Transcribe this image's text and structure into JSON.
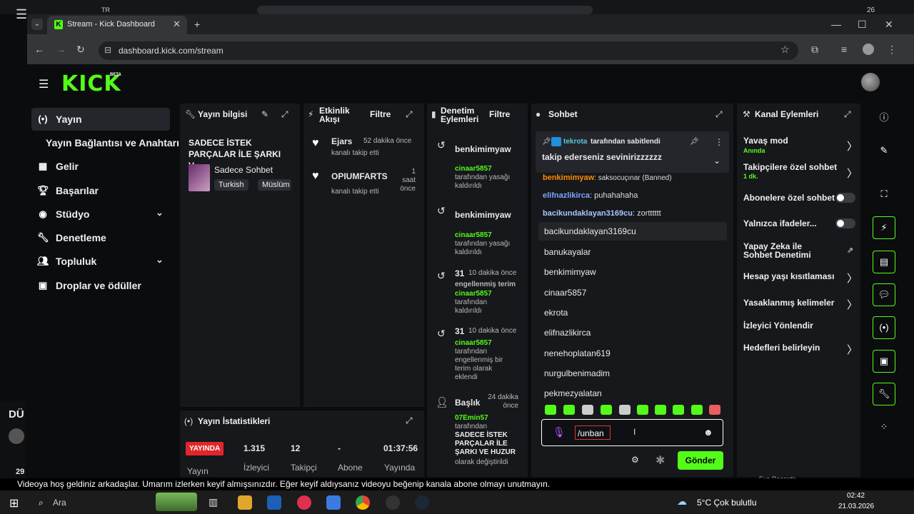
{
  "os": {
    "lang": "TR",
    "date_top": "26"
  },
  "browser": {
    "tab_title": "Stream - Kick Dashboard",
    "url": "dashboard.kick.com/stream"
  },
  "kick": {
    "logo": "KICK",
    "beta": "BETA"
  },
  "sidebar": {
    "items": [
      {
        "label": "Yayın",
        "icon": "broadcast-icon"
      },
      {
        "label": "Yayın Bağlantısı ve Anahtarı"
      },
      {
        "label": "Gelir",
        "icon": "chart-icon"
      },
      {
        "label": "Başarılar",
        "icon": "trophy-icon"
      },
      {
        "label": "Stüdyo",
        "icon": "palette-icon"
      },
      {
        "label": "Denetleme",
        "icon": "wrench-icon"
      },
      {
        "label": "Topluluk",
        "icon": "users-icon"
      },
      {
        "label": "Droplar ve ödüller",
        "icon": "gift-icon"
      }
    ]
  },
  "stream_info": {
    "header": "Yayın bilgisi",
    "title": "SADECE İSTEK PARÇALAR İLE ŞARKI V...",
    "category": "Sadece Sohbet",
    "tags": [
      "Turkish",
      "Müslüm"
    ]
  },
  "activity": {
    "header": "Etkinlik Akışı",
    "filter": "Filtre",
    "items": [
      {
        "name": "Ejars",
        "time": "52 dakika önce",
        "action": "kanalı takip etti"
      },
      {
        "name": "OPIUMFARTS",
        "time": "1 saat önce",
        "action": "kanalı takip etti"
      }
    ]
  },
  "moderation": {
    "header": "Denetim Eylemleri",
    "filter": "Filtre",
    "items": [
      {
        "user": "benkimimyaw",
        "mod": "cinaar5857",
        "text": "tarafından yasağı kaldırıldı"
      },
      {
        "user": "benkimimyaw",
        "mod": "cinaar5857",
        "text": "tarafından yasağı kaldırıldı"
      },
      {
        "user": "31",
        "time": "10 dakika önce",
        "pre": "engellenmiş terim",
        "mod": "cinaar5857",
        "text": "tarafından kaldırıldı"
      },
      {
        "user": "31",
        "time": "10 dakika önce",
        "mod": "cinaar5857",
        "text": "tarafından engellenmiş bir terim olarak eklendi"
      },
      {
        "user": "Başlık",
        "time": "24 dakika önce",
        "mod": "07Emin57",
        "text": "tarafından",
        "bold": "SADECE İSTEK PARÇALAR İLE ŞARKI VE HUZUR",
        "after": "olarak değiştirildi"
      }
    ]
  },
  "chat": {
    "header": "Sohbet",
    "pinned_by": "tekrota",
    "pinned_suffix": "tarafından sabitlendi",
    "pinned_msg": "takip ederseniz sevinirizzzzzz",
    "messages": [
      {
        "user": "benkimimyaw",
        "text": ": saksocuçınar (Banned)",
        "color": "#ff8c00"
      },
      {
        "user": "elifnazlikirca",
        "text": ": puhahahaha",
        "color": "#7aa6ff"
      },
      {
        "user": "bacikundaklayan3169cu",
        "text": ": zortttttt",
        "color": "#a9c7ff"
      }
    ],
    "mentions": [
      "bacikundaklayan3169cu",
      "banukayalar",
      "benkimimyaw",
      "cinaar5857",
      "ekrota",
      "elifnazlikirca",
      "nenehoplatan619",
      "nurgulbenimadim",
      "pekmezyalatan"
    ],
    "input_value": "/unban",
    "send": "Gönder"
  },
  "stats": {
    "header": "Yayın İstatistikleri",
    "live_badge": "YAYINDA",
    "values": [
      "1.315",
      "12",
      "-",
      "01:37:56"
    ],
    "labels": [
      "Yayın",
      "İzleyici",
      "Takipçi",
      "Abone",
      "Yayında"
    ]
  },
  "channel_actions": {
    "header": "Kanal Eylemleri",
    "items": [
      {
        "label": "Yavaş mod",
        "sub": "Anında"
      },
      {
        "label": "Takipçilere özel sohbet",
        "sub": "1 dk."
      },
      {
        "label": "Abonelere özel sohbet"
      },
      {
        "label": "Yalnızca ifadeler..."
      },
      {
        "label": "Yapay Zeka ile Sohbet Denetimi"
      },
      {
        "label": "Hesap yaşı kısıtlaması"
      },
      {
        "label": "Yasaklanmış kelimeler"
      },
      {
        "label": "İzleyici Yönlendir"
      },
      {
        "label": "Hedefleri belirleyin"
      }
    ]
  },
  "overlay": {
    "du": "DÜ",
    "num": "29",
    "subtitle": "Videoya hoş geldiniz arkadaşlar. Umarım izlerken keyif almışsınızdır. Eğer keyif aldıysanız videoyu beğenip kanala abone olmayı unutmayın.",
    "eva": "Eva Records"
  },
  "taskbar": {
    "search": "Ara",
    "weather": "5°C  Çok bulutlu",
    "time": "02:42",
    "date": "21.03.2026"
  }
}
